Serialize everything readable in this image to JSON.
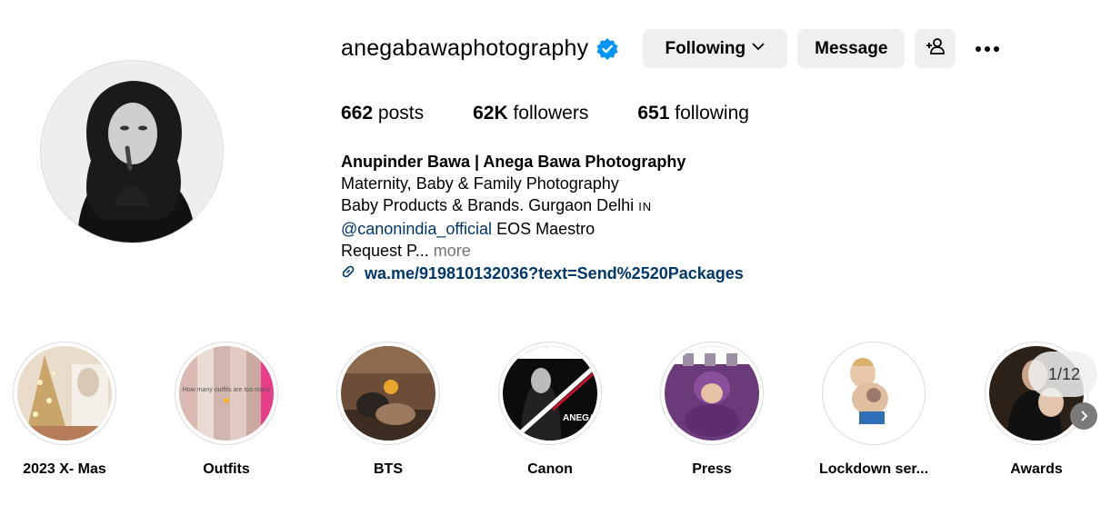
{
  "profile": {
    "username": "anegabawaphotography",
    "verified_icon": "verified-badge-icon",
    "following_label": "Following",
    "message_label": "Message",
    "add_user_icon": "add-user-icon",
    "more_icon": "more-options-icon",
    "accent_color": "#0095f6"
  },
  "stats": {
    "posts_count": "662",
    "posts_label": "posts",
    "followers_count": "62K",
    "followers_label": "followers",
    "following_count": "651",
    "following_label": "following"
  },
  "bio": {
    "name": "Anupinder Bawa | Anega Bawa Photography",
    "line1": "Maternity, Baby & Family Photography",
    "line2": "Baby Products & Brands. Gurgaon Delhi",
    "flag": "IN",
    "mention": "@canonindia_official",
    "mention_suffix": " EOS Maestro",
    "truncated": "Request P...",
    "more_label": "more",
    "link_icon": "link-icon",
    "link": "wa.me/919810132036?text=Send%2520Packages",
    "link_color": "#00376b"
  },
  "highlights": [
    {
      "label": "2023 X- Mas"
    },
    {
      "label": "Outfits",
      "overlay_text": "How many outfits are too many"
    },
    {
      "label": "BTS"
    },
    {
      "label": "Canon",
      "overlay_text": "ANEGA BAWA"
    },
    {
      "label": "Press"
    },
    {
      "label": "Lockdown ser..."
    },
    {
      "label": "Awards"
    }
  ],
  "carousel": {
    "counter": "1/12",
    "next_icon": "chevron-right-icon"
  }
}
